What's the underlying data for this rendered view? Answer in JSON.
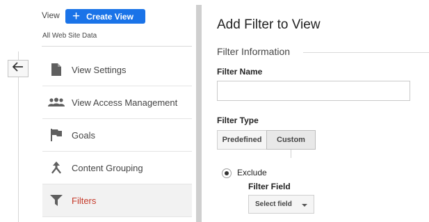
{
  "header": {
    "view_label": "View",
    "create_view_label": "Create View",
    "view_name": "All Web Site Data"
  },
  "sidebar": {
    "items": [
      {
        "label": "View Settings",
        "icon": "document-icon"
      },
      {
        "label": "View Access Management",
        "icon": "people-icon"
      },
      {
        "label": "Goals",
        "icon": "flag-icon"
      },
      {
        "label": "Content Grouping",
        "icon": "content-grouping-icon"
      },
      {
        "label": "Filters",
        "icon": "filter-icon",
        "active": true
      }
    ]
  },
  "panel": {
    "title": "Add Filter to View",
    "section": "Filter Information",
    "filter_name_label": "Filter Name",
    "filter_name_value": "",
    "filter_type_label": "Filter Type",
    "type_options": [
      "Predefined",
      "Custom"
    ],
    "selected_type": "Custom",
    "radio_label": "Exclude",
    "filter_field_label": "Filter Field",
    "select_field_value": "Select field"
  },
  "colors": {
    "accent": "#1a73e8",
    "active_text": "#c53929",
    "active_bg": "#f2f2f2"
  }
}
